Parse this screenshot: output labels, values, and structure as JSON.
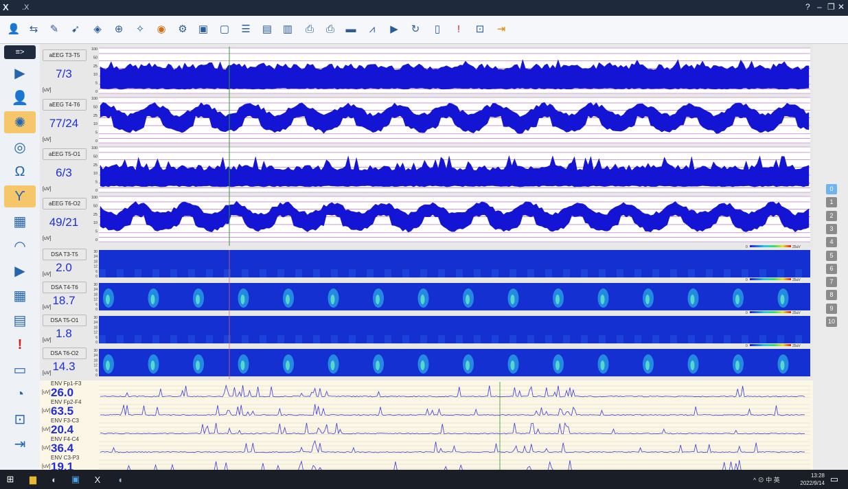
{
  "window": {
    "title": ".X",
    "logo": "X",
    "controls": [
      "?",
      "–",
      "❐",
      "✕"
    ]
  },
  "toolbar": {
    "icons": [
      "patient-icon",
      "montage-icon",
      "montage-edit-icon",
      "montage-arrow-icon",
      "layer-icon",
      "zoom-icon",
      "filter-icon",
      "color-wheel-icon",
      "analysis-icon",
      "screenshot-icon",
      "frame-icon",
      "list-icon",
      "report-icon",
      "add-report-icon",
      "print-icon",
      "print-color-icon",
      "spectrum-icon",
      "chart-icon",
      "video-icon",
      "replay-icon",
      "book-icon",
      "alarm-icon",
      "lock-icon",
      "exit-icon"
    ]
  },
  "sidebar": {
    "items": [
      {
        "name": "collapse-icon",
        "glyph": "≡>",
        "active": false
      },
      {
        "name": "play-icon",
        "glyph": "▶",
        "active": false
      },
      {
        "name": "patient-icon",
        "glyph": "👤",
        "active": false
      },
      {
        "name": "brain-icon",
        "glyph": "✺",
        "active": true
      },
      {
        "name": "target-icon",
        "glyph": "◎",
        "active": false
      },
      {
        "name": "omega-icon",
        "glyph": "Ω",
        "active": false
      },
      {
        "name": "gamma-icon",
        "glyph": "ϒ",
        "active": true
      },
      {
        "name": "eeg-trend-icon",
        "glyph": "▦",
        "active": false
      },
      {
        "name": "gauge-icon",
        "glyph": "◠",
        "active": false
      },
      {
        "name": "video-icon",
        "glyph": "▶",
        "active": false
      },
      {
        "name": "grid-icon",
        "glyph": "▦",
        "active": false
      },
      {
        "name": "notes-icon",
        "glyph": "▤",
        "active": false
      },
      {
        "name": "alarm-icon",
        "glyph": "!",
        "active": false
      },
      {
        "name": "layout-icon",
        "glyph": "▭",
        "active": false
      },
      {
        "name": "measure-icon",
        "glyph": "◔",
        "active": false
      },
      {
        "name": "lock-icon",
        "glyph": "⊡",
        "active": false
      },
      {
        "name": "exit-icon",
        "glyph": "⇥",
        "active": false
      }
    ]
  },
  "aeeg": [
    {
      "label": "aEEG T3-T5",
      "value": "7/3",
      "unit": "[uV]",
      "pattern": "flat"
    },
    {
      "label": "aEEG T4-T6",
      "value": "77/24",
      "unit": "[uV]",
      "pattern": "wave"
    },
    {
      "label": "aEEG T5-O1",
      "value": "6/3",
      "unit": "[uV]",
      "pattern": "spiky"
    },
    {
      "label": "aEEG T6-O2",
      "value": "49/21",
      "unit": "[uV]",
      "pattern": "wave"
    }
  ],
  "aeeg_scale": [
    "100",
    "50",
    "25",
    "10",
    "5",
    "0"
  ],
  "dsa": [
    {
      "label": "DSA T3-T5",
      "value": "2.0",
      "unit": "[uV]",
      "pattern": "low"
    },
    {
      "label": "DSA T4-T6",
      "value": "18.7",
      "unit": "[uV]",
      "pattern": "bursts"
    },
    {
      "label": "DSA T5-O1",
      "value": "1.8",
      "unit": "[uV]",
      "pattern": "low"
    },
    {
      "label": "DSA T6-O2",
      "value": "14.3",
      "unit": "[uV]",
      "pattern": "bursts"
    }
  ],
  "dsa_scale": [
    "30",
    "24",
    "18",
    "12",
    "6",
    "0"
  ],
  "dsa_colorbar": {
    "min": "0",
    "max": "25uV"
  },
  "env": [
    {
      "label": "ENV Fp1-F3",
      "value": "26.0",
      "unit": "[uV]"
    },
    {
      "label": "ENV Fp2-F4",
      "value": "63.5",
      "unit": "[uV]"
    },
    {
      "label": "ENV F3-C3",
      "value": "20.4",
      "unit": "[uV]"
    },
    {
      "label": "ENV F4-C4",
      "value": "36.4",
      "unit": "[uV]"
    },
    {
      "label": "ENV C3-P3",
      "value": "19.1",
      "unit": "[uV]"
    }
  ],
  "pages": [
    "0",
    "1",
    "2",
    "3",
    "4",
    "5",
    "6",
    "7",
    "8",
    "9",
    "10"
  ],
  "selected_page": "0",
  "colors": {
    "trace": "#1414d4",
    "dsa_bg": "#1530d0",
    "env": "#3a3ad8",
    "panel": "#fbf6e6"
  },
  "taskbar": {
    "icons": [
      "windows-icon",
      "explorer-icon",
      "browser-icon",
      "app-icon",
      "eeg-app-icon",
      "chat-icon"
    ],
    "tray": "^  ⊘  中  英",
    "time": "13:28",
    "date": "2022/9/14"
  }
}
